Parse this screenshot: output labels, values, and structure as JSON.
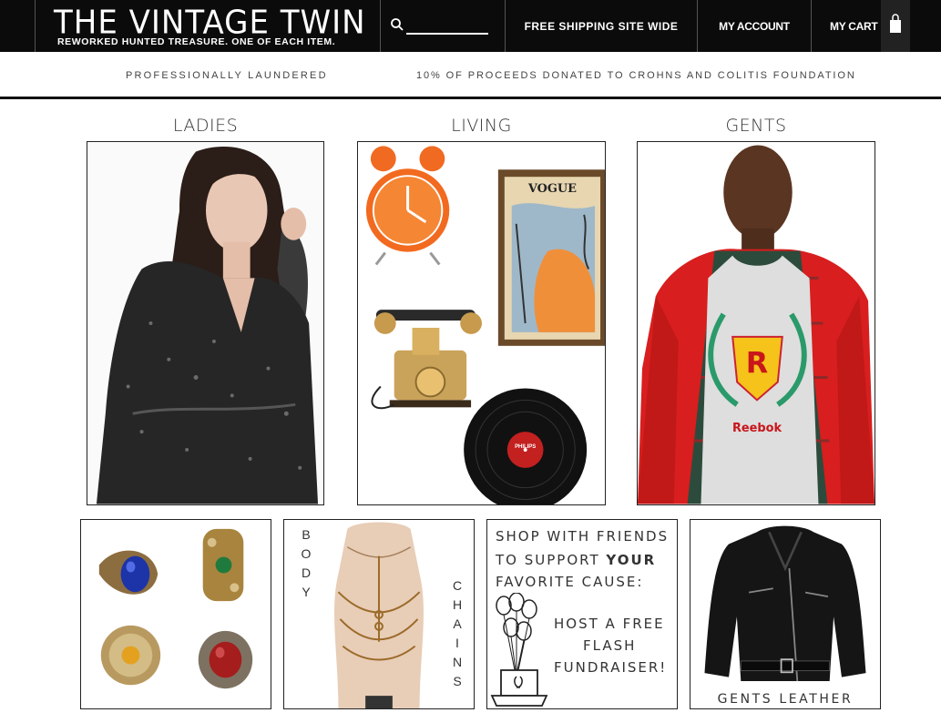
{
  "brand": {
    "name": "THE VINTAGE TWIN",
    "tagline": "REWORKED HUNTED TREASURE. ONE OF EACH ITEM."
  },
  "search": {
    "placeholder": "",
    "value": ""
  },
  "nav": {
    "shipping": "FREE SHIPPING SITE WIDE",
    "account": "MY ACCOUNT",
    "cart": "MY CART"
  },
  "subbar": {
    "left": "PROFESSIONALLY LAUNDERED",
    "right": "10% OF PROCEEDS DONATED TO CROHNS AND COLITIS FOUNDATION"
  },
  "categories": [
    {
      "title": "LADIES"
    },
    {
      "title": "LIVING"
    },
    {
      "title": "GENTS"
    }
  ],
  "living_tile": {
    "poster_text": "VOGUE",
    "record_label": "PHILIPS"
  },
  "gents_tile": {
    "shirt_letter": "R",
    "shirt_brand": "Reebok"
  },
  "body_chains": {
    "word1": [
      "B",
      "O",
      "D",
      "Y"
    ],
    "word2": [
      "C",
      "H",
      "A",
      "I",
      "N",
      "S"
    ]
  },
  "promo": {
    "line1": "SHOP WITH FRIENDS",
    "line2a": "TO SUPPORT ",
    "line2b": "YOUR",
    "line3": "FAVORITE CAUSE:",
    "line4": "HOST A FREE",
    "line5": "FLASH",
    "line6": "FUNDRAISER!"
  },
  "leather": {
    "label": "GENTS LEATHER"
  },
  "colors": {
    "header_bg": "#0b0b0b",
    "header_text": "#ffffff",
    "body_text": "#333333"
  }
}
